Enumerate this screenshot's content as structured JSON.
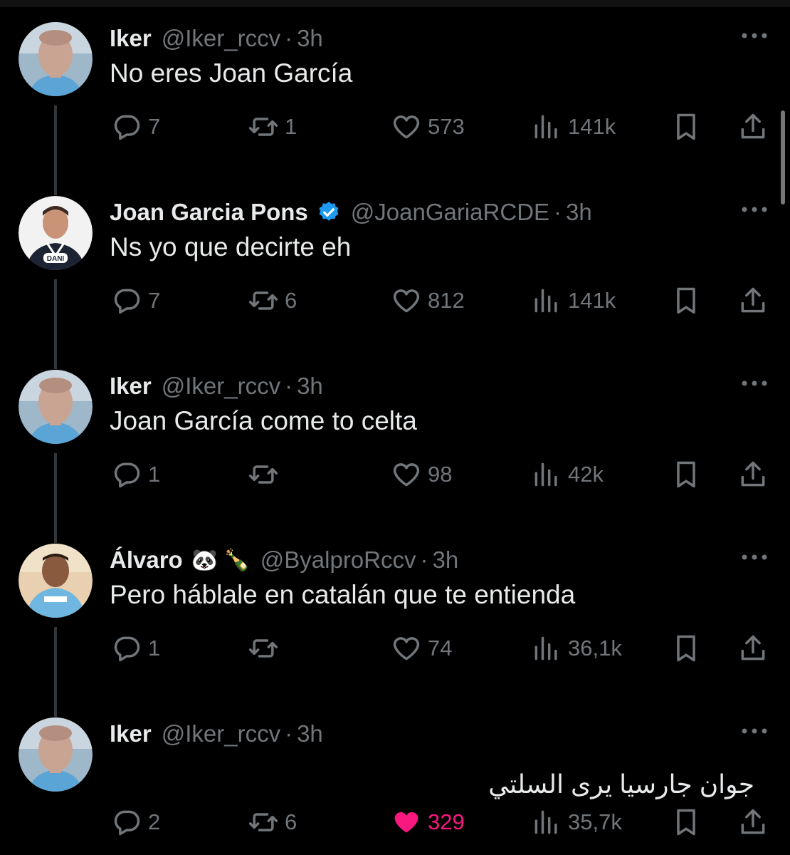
{
  "tweets": [
    {
      "name": "Iker",
      "handle": "@Iker_rccv",
      "time": "3h",
      "text": "No eres Joan García",
      "replies": "7",
      "retweets": "1",
      "likes": "573",
      "views": "141k"
    },
    {
      "name": "Joan Garcia Pons",
      "handle": "@JoanGariaRCDE",
      "time": "3h",
      "text": "Ns yo que decirte eh",
      "replies": "7",
      "retweets": "6",
      "likes": "812",
      "views": "141k",
      "verified": true,
      "avatar_text": "DANI"
    },
    {
      "name": "Iker",
      "handle": "@Iker_rccv",
      "time": "3h",
      "text": "Joan García come to celta",
      "replies": "1",
      "retweets": "",
      "likes": "98",
      "views": "42k"
    },
    {
      "name": "Álvaro",
      "name_emoji": "🐼 🍾",
      "handle": "@ByalproRccv",
      "time": "3h",
      "text": "Pero háblale en catalán que te entienda",
      "replies": "1",
      "retweets": "",
      "likes": "74",
      "views": "36,1k"
    },
    {
      "name": "Iker",
      "handle": "@Iker_rccv",
      "time": "3h",
      "text": "جوان جارسيا يرى السلتي",
      "replies": "2",
      "retweets": "6",
      "likes": "329",
      "views": "35,7k",
      "liked": true
    }
  ],
  "separator_dot": "·",
  "colors": {
    "background": "#000000",
    "text": "#e7e9ea",
    "secondary": "#71767b",
    "verified": "#1d9bf0",
    "liked": "#f91880",
    "thread_line": "#333639"
  },
  "icons": [
    "reply-icon",
    "retweet-icon",
    "heart-icon",
    "views-icon",
    "bookmark-icon",
    "share-icon",
    "more-icon",
    "verified-icon"
  ]
}
